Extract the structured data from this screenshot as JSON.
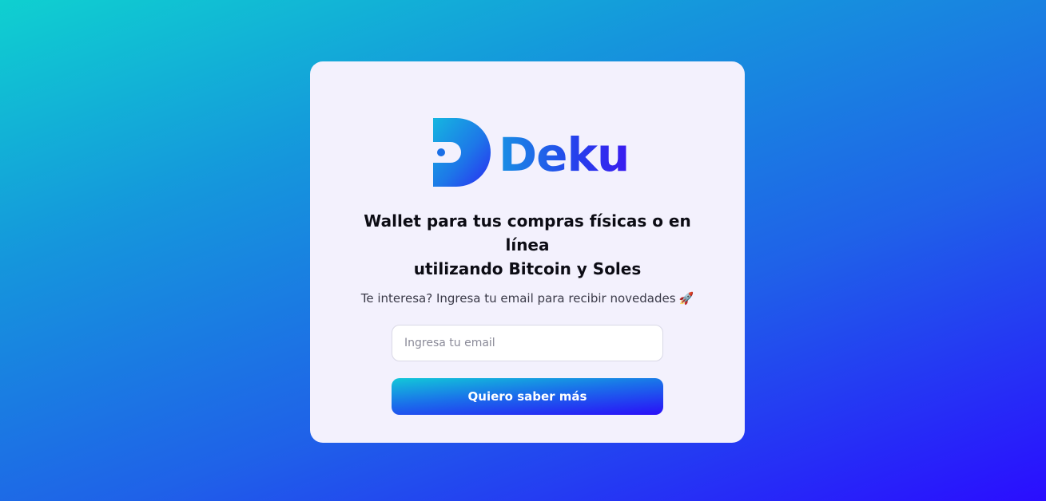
{
  "brand": {
    "name": "Deku",
    "logo_icon": "deku-d-logo-icon"
  },
  "hero": {
    "headline_line1": "Wallet para tus compras físicas o en línea",
    "headline_line2": "utilizando Bitcoin y Soles"
  },
  "signup": {
    "prompt": "Te interesa? Ingresa tu email para recibir novedades",
    "prompt_emoji": "🚀",
    "email_value": "",
    "email_placeholder": "Ingresa tu email",
    "button_label": "Quiero saber más"
  },
  "colors": {
    "background_start": "#0fd0d0",
    "background_end": "#2a0dff",
    "card_background": "#f3f1fd",
    "logo_text": "#2640ec"
  }
}
